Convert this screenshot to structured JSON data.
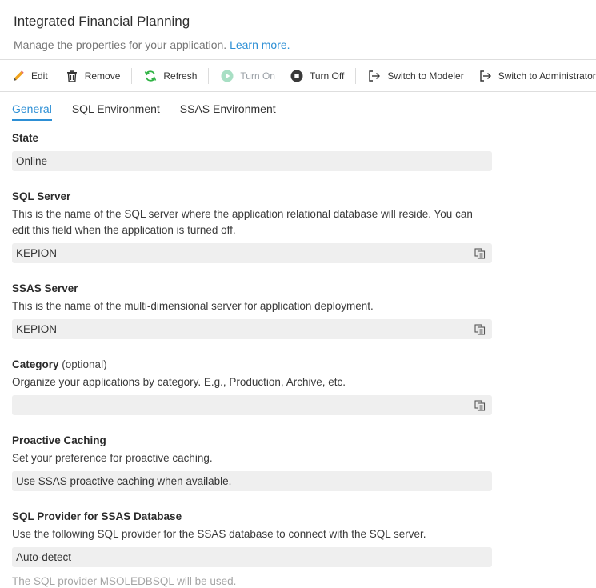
{
  "header": {
    "title": "Integrated Financial Planning",
    "subtitle": "Manage the properties for your application.",
    "learn_more": "Learn more."
  },
  "toolbar": {
    "edit": "Edit",
    "remove": "Remove",
    "refresh": "Refresh",
    "turn_on": "Turn On",
    "turn_off": "Turn Off",
    "switch_modeler": "Switch to Modeler",
    "switch_admin": "Switch to Administrator"
  },
  "tabs": [
    {
      "label": "General",
      "active": true
    },
    {
      "label": "SQL Environment",
      "active": false
    },
    {
      "label": "SSAS Environment",
      "active": false
    }
  ],
  "general": {
    "state": {
      "label": "State",
      "value": "Online"
    },
    "sql_server": {
      "label": "SQL Server",
      "description": "This is the name of the SQL server where the application relational database will reside. You can edit this field when the application is turned off.",
      "value": "KEPION"
    },
    "ssas_server": {
      "label": "SSAS Server",
      "description": "This is the name of the multi-dimensional server for application deployment.",
      "value": "KEPION"
    },
    "category": {
      "label": "Category",
      "optional": "(optional)",
      "description": "Organize your applications by category. E.g., Production, Archive, etc.",
      "value": ""
    },
    "proactive_caching": {
      "label": "Proactive Caching",
      "description": "Set your preference for proactive caching.",
      "value": "Use SSAS proactive caching when available."
    },
    "sql_provider": {
      "label": "SQL Provider for SSAS Database",
      "description": "Use the following SQL provider for the SSAS database to connect with the SQL server.",
      "value": "Auto-detect",
      "note": "The SQL provider MSOLEDBSQL will be used."
    }
  },
  "colors": {
    "accent": "#2d8fd5",
    "refresh_green": "#2fb344",
    "field_bg": "#efefef"
  },
  "icons": [
    "pencil-icon",
    "trash-icon",
    "refresh-icon",
    "play-icon",
    "stop-icon",
    "switch-icon",
    "copy-icon"
  ]
}
